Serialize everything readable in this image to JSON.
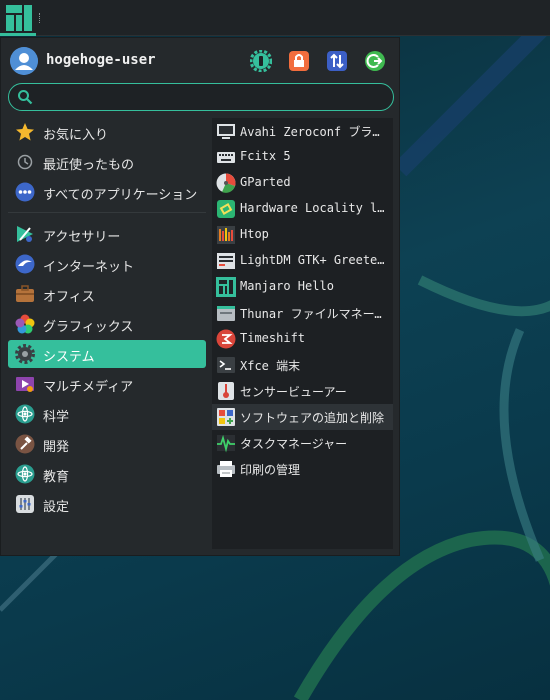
{
  "user": {
    "name": "hogehoge-user"
  },
  "actions": [
    {
      "icon": "settings-icon"
    },
    {
      "icon": "lock-icon"
    },
    {
      "icon": "switch-user-icon"
    },
    {
      "icon": "logout-icon"
    }
  ],
  "search": {
    "value": "",
    "placeholder": ""
  },
  "categories_top": [
    {
      "label": "お気に入り",
      "icon": "star-icon"
    },
    {
      "label": "最近使ったもの",
      "icon": "clock-icon"
    },
    {
      "label": "すべてのアプリケーション",
      "icon": "all-apps-icon"
    }
  ],
  "categories": [
    {
      "label": "アクセサリー",
      "icon": "accessories-icon"
    },
    {
      "label": "インターネット",
      "icon": "internet-icon"
    },
    {
      "label": "オフィス",
      "icon": "office-icon"
    },
    {
      "label": "グラフィックス",
      "icon": "graphics-icon"
    },
    {
      "label": "システム",
      "icon": "system-icon",
      "active": true
    },
    {
      "label": "マルチメディア",
      "icon": "multimedia-icon"
    },
    {
      "label": "科学",
      "icon": "science-icon"
    },
    {
      "label": "開発",
      "icon": "development-icon"
    },
    {
      "label": "教育",
      "icon": "education-icon"
    },
    {
      "label": "設定",
      "icon": "settings-category-icon"
    }
  ],
  "apps": [
    {
      "label": "Avahi Zeroconf ブラウザー",
      "icon": "avahi-icon"
    },
    {
      "label": "Fcitx 5",
      "icon": "keyboard-icon"
    },
    {
      "label": "GParted",
      "icon": "gparted-icon"
    },
    {
      "label": "Hardware Locality lstopo",
      "icon": "hwloc-icon"
    },
    {
      "label": "Htop",
      "icon": "htop-icon"
    },
    {
      "label": "LightDM GTK+ Greeter settings",
      "icon": "lightdm-icon"
    },
    {
      "label": "Manjaro Hello",
      "icon": "manjaro-icon"
    },
    {
      "label": "Thunar ファイルマネージャー",
      "icon": "thunar-icon"
    },
    {
      "label": "Timeshift",
      "icon": "timeshift-icon"
    },
    {
      "label": "Xfce 端末",
      "icon": "terminal-icon"
    },
    {
      "label": "センサービューアー",
      "icon": "sensor-icon"
    },
    {
      "label": "ソフトウェアの追加と削除",
      "icon": "software-icon",
      "hover": true
    },
    {
      "label": "タスクマネージャー",
      "icon": "task-manager-icon"
    },
    {
      "label": "印刷の管理",
      "icon": "printer-icon"
    }
  ],
  "colors": {
    "accent": "#35bf9c",
    "menu_bg": "#25292c",
    "list_bg": "#1d2023"
  }
}
